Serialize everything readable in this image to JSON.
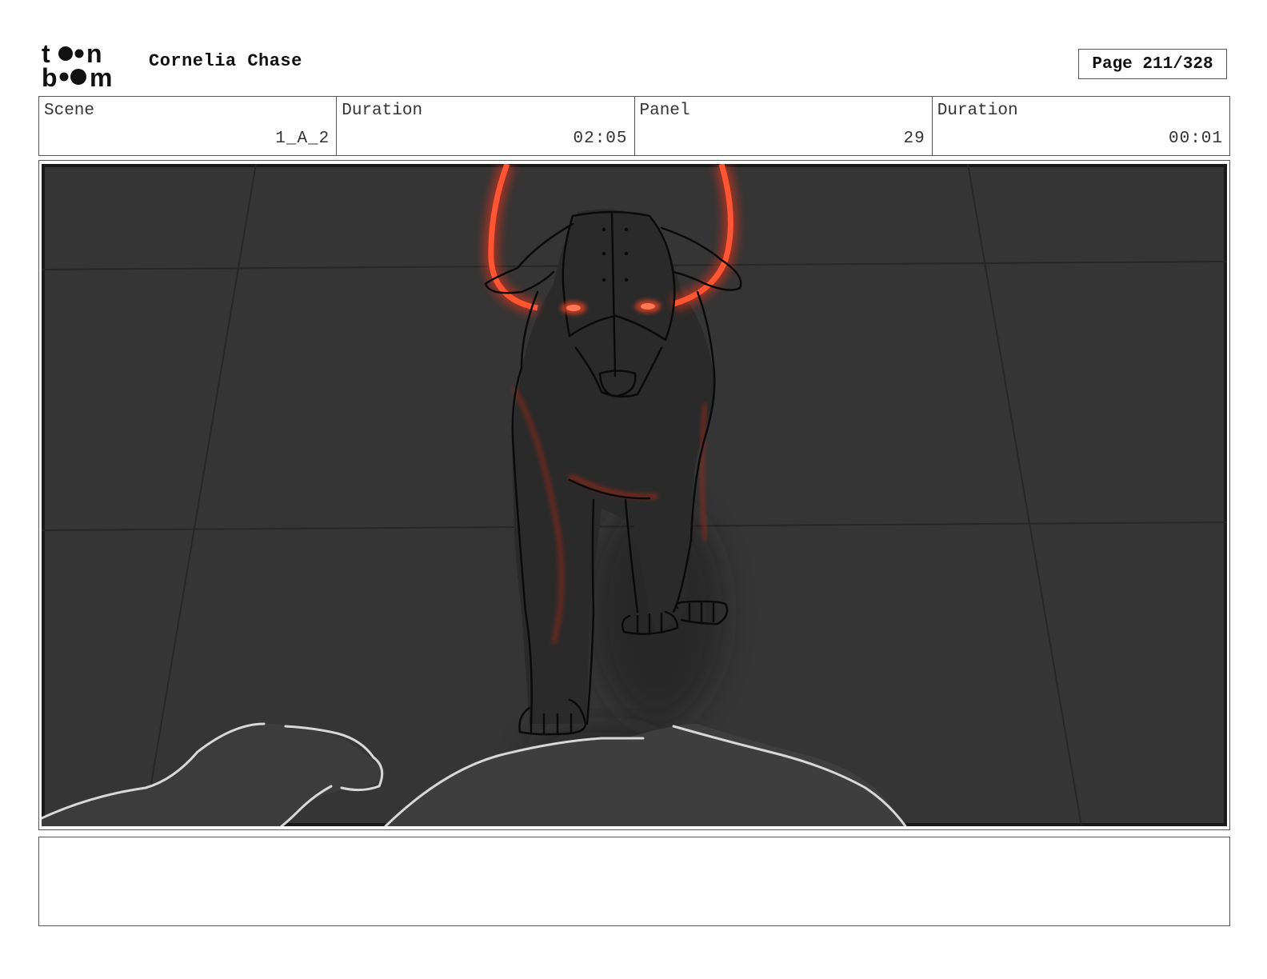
{
  "header": {
    "logo_line1": "toon",
    "logo_line2": "boom",
    "project_title": "Cornelia Chase",
    "page_label": "Page 211/328"
  },
  "info": [
    {
      "label": "Scene",
      "value": "1_A_2"
    },
    {
      "label": "Duration",
      "value": "02:05"
    },
    {
      "label": "Panel",
      "value": "29"
    },
    {
      "label": "Duration",
      "value": "00:01"
    }
  ],
  "panel": {
    "background_color": "#353535",
    "glow_color": "#e0321e",
    "sketch_line_color": "#0a0a0a",
    "foreground_line_color": "#d8d8d8"
  },
  "notes": {
    "text": ""
  }
}
